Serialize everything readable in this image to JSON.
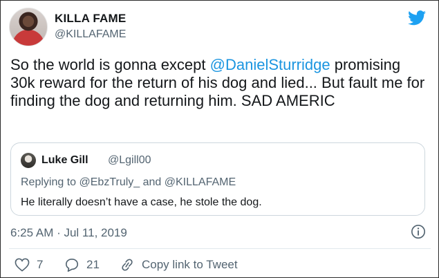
{
  "author": {
    "name": "KILLA FAME",
    "handle": "@KILLAFAME"
  },
  "tweet": {
    "text_before": "So the world is gonna except ",
    "mention": "@DanielSturridge",
    "text_after": " promising 30k reward for the return of his dog and lied... But fault me for finding the dog and returning him.  SAD AMERIC"
  },
  "quoted": {
    "name": "Luke Gill",
    "handle": "@Lgill00",
    "replying_prefix": "Replying to ",
    "replying_to_1": "@EbzTruly_",
    "replying_and": " and ",
    "replying_to_2": "@KILLAFAME",
    "text": "He literally doesn’t have a case, he stole the dog."
  },
  "timestamp": "6:25 AM · Jul 11, 2019",
  "actions": {
    "likes": "7",
    "replies": "21",
    "copy_link": "Copy link to Tweet"
  },
  "colors": {
    "accent": "#1b95e0",
    "muted": "#536471",
    "text": "#14171a"
  }
}
